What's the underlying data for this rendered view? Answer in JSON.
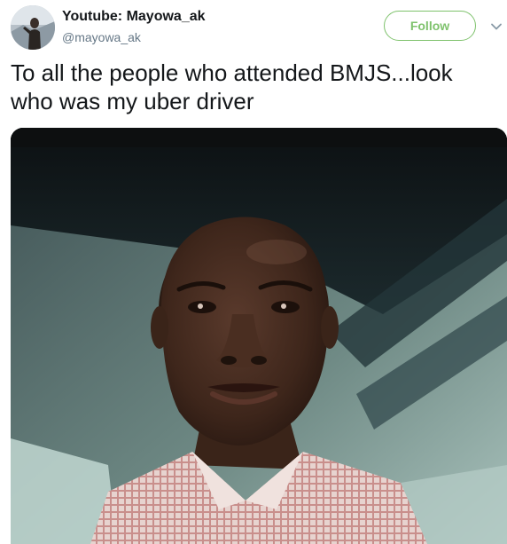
{
  "tweet": {
    "author": {
      "display_name": "Youtube: Mayowa_ak",
      "handle": "@mayowa_ak",
      "avatar_icon": "user-avatar"
    },
    "follow_label": "Follow",
    "menu_icon": "chevron-down-icon",
    "text": "To all the people who attended BMJS...look who was my uber driver",
    "media": {
      "type": "photo",
      "icon": "photo-of-man-selfie"
    }
  },
  "colors": {
    "follow_accent": "#7ec26c",
    "text_primary": "#14171a",
    "text_secondary": "#657786"
  }
}
